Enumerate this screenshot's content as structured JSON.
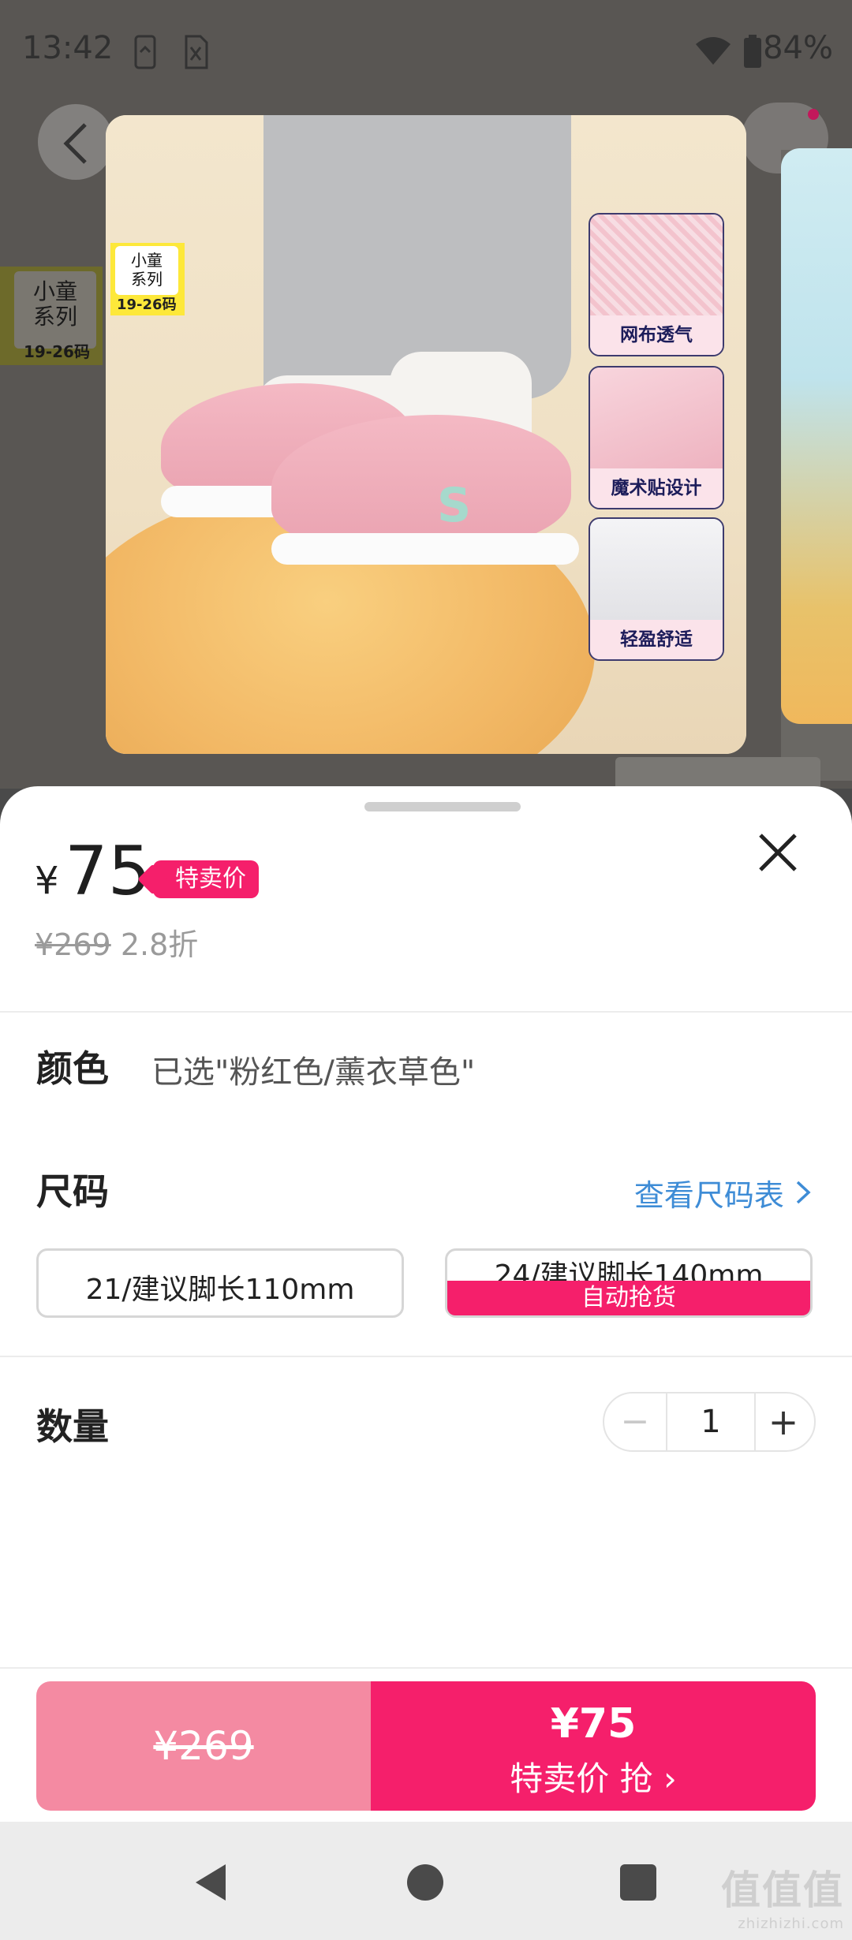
{
  "status_bar": {
    "time": "13:42",
    "battery": "84%"
  },
  "preview": {
    "series_tag": {
      "line1": "小童",
      "line2": "系列",
      "size": "19-26码"
    },
    "features": [
      "网布透气",
      "魔术贴设计",
      "轻盈舒适"
    ]
  },
  "product": {
    "currency": "¥",
    "price": "75",
    "price_tag": "特卖价",
    "original_price": "¥269",
    "discount": "2.8折"
  },
  "color": {
    "label": "颜色",
    "selected": "已选\"粉红色/薰衣草色\""
  },
  "size": {
    "label": "尺码",
    "chart_link": "查看尺码表",
    "options": [
      {
        "label": "21/建议脚长110mm"
      },
      {
        "label": "24/建议脚长140mm",
        "badge": "自动抢货"
      }
    ]
  },
  "quantity": {
    "label": "数量",
    "minus": "−",
    "value": "1",
    "plus": "+"
  },
  "action": {
    "original_price": "¥269",
    "buy_price": "¥75",
    "buy_label": "特卖价 抢 ›"
  },
  "watermark": {
    "text": "值值值",
    "url": "zhizhizhi.com"
  },
  "colors": {
    "accent": "#f51f6b",
    "accent_light": "#f48aa2",
    "link": "#3e8cd6"
  }
}
